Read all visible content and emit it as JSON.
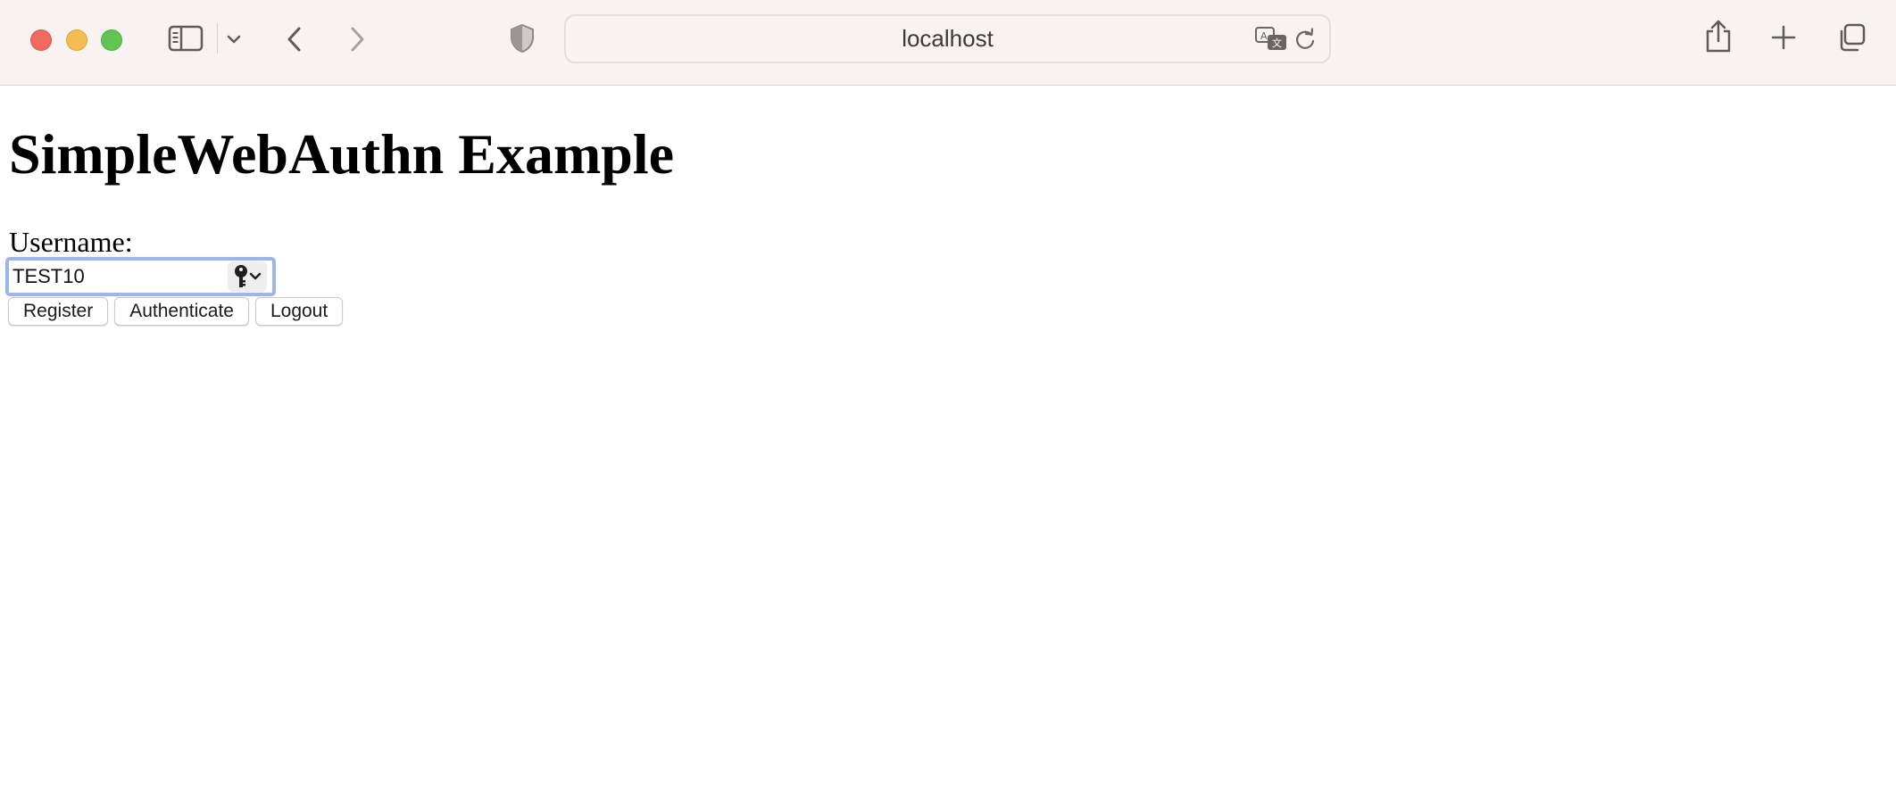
{
  "browser": {
    "address": "localhost",
    "icons": {
      "close": "red-close-light",
      "minimize": "yellow-minimize-light",
      "zoom": "green-zoom-light",
      "sidebar": "sidebar-icon",
      "tab_group_menu": "chevron-down-icon",
      "back": "chevron-left-icon",
      "forward": "chevron-right-icon",
      "privacy": "shield-icon",
      "translate": "translate-icon",
      "reload": "reload-icon",
      "share": "share-icon",
      "new_tab": "plus-icon",
      "tab_overview": "tabs-overview-icon"
    },
    "colors": {
      "toolbar_bg": "#f8f3f1",
      "focus_ring": "#9bb6ee"
    }
  },
  "page": {
    "title": "SimpleWebAuthn Example",
    "username_label": "Username:",
    "username_value": "TEST10",
    "buttons": {
      "register": "Register",
      "authenticate": "Authenticate",
      "logout": "Logout"
    }
  }
}
